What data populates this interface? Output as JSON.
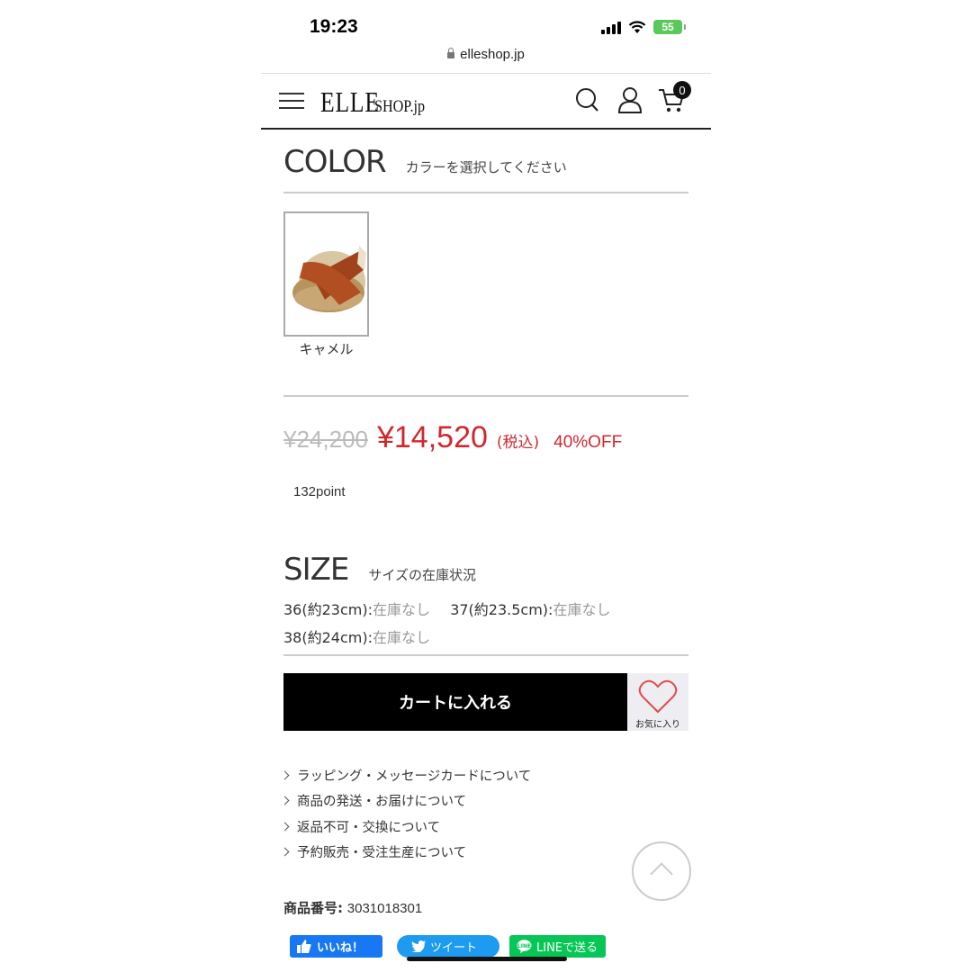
{
  "status_bar": {
    "time": "19:23",
    "battery": "55"
  },
  "browser": {
    "url": "elleshop.jp"
  },
  "header": {
    "logo_main": "ELLE",
    "logo_sub": "SHOP.jp",
    "cart_count": "0"
  },
  "color_section": {
    "title": "COLOR",
    "subtitle": "カラーを選択してください",
    "swatches": [
      {
        "label": "キャメル"
      }
    ]
  },
  "price": {
    "original": "¥24,200",
    "sale": "¥14,520",
    "tax_note": "(税込)",
    "discount": "40%OFF",
    "points": "132point"
  },
  "size_section": {
    "title": "SIZE",
    "subtitle": "サイズの在庫状況",
    "sizes": [
      {
        "label": "36(約23cm):",
        "status": "在庫なし"
      },
      {
        "label": "37(約23.5cm):",
        "status": "在庫なし"
      },
      {
        "label": "38(約24cm):",
        "status": "在庫なし"
      }
    ]
  },
  "actions": {
    "cart_button": "カートに入れる",
    "favorite_label": "お気に入り"
  },
  "info_links": [
    "ラッピング・メッセージカードについて",
    "商品の発送・お届けについて",
    "返品不可・交換について",
    "予約販売・受注生産について"
  ],
  "product": {
    "number_label": "商品番号:",
    "number_value": "3031018301"
  },
  "share": {
    "facebook": "いいね！",
    "twitter": "ツイート",
    "line": "LINEで送る"
  },
  "colors": {
    "accent_red": "#d0282e",
    "facebook": "#1877f2",
    "twitter": "#1d9bf0",
    "line": "#06c755"
  }
}
